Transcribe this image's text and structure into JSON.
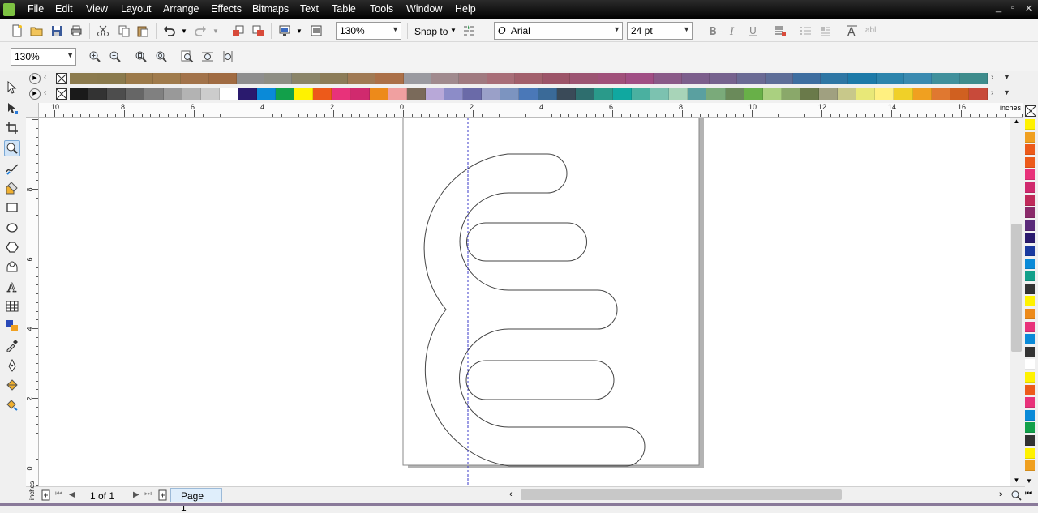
{
  "menubar": {
    "items": [
      "File",
      "Edit",
      "View",
      "Layout",
      "Arrange",
      "Effects",
      "Bitmaps",
      "Text",
      "Table",
      "Tools",
      "Window",
      "Help"
    ]
  },
  "standard_toolbar": {
    "zoom_level": "130%",
    "snap_to_label": "Snap to",
    "font_name": "Arial",
    "font_glyph": "O",
    "font_size": "24 pt"
  },
  "zoom_toolbar": {
    "zoom_level": "130%"
  },
  "rulers": {
    "unit": "inches",
    "horizontal_labels": [
      "10",
      "8",
      "6",
      "4",
      "2",
      "0",
      "2",
      "4",
      "6",
      "8",
      "10",
      "12",
      "14",
      "16"
    ],
    "vertical_labels": [
      "8",
      "6",
      "4",
      "2",
      "0"
    ]
  },
  "status": {
    "page_count": "1 of 1",
    "page_tab": "Page 1",
    "unit": "inches"
  },
  "palette": {
    "row1": [
      "#8c7b4e",
      "#8a7a4d",
      "#9c7a4a",
      "#a07b4c",
      "#a2734a",
      "#a06b42",
      "#8e8e8e",
      "#8e8e84",
      "#8a8468",
      "#8c7c58",
      "#a07a54",
      "#ab7048",
      "#9a9aa0",
      "#a08a8e",
      "#a07a80",
      "#a86e78",
      "#a2606c",
      "#9c5468",
      "#9c5472",
      "#a0507a",
      "#a04e84",
      "#8a5a88",
      "#7c5e8c",
      "#76628e",
      "#6a6a94",
      "#5e6e98",
      "#3e6ea0",
      "#2e76a4",
      "#1c7aa8",
      "#2c84ac",
      "#3a8ab0",
      "#40909c",
      "#3e8c8c"
    ],
    "row2": [
      "#1a1a1a",
      "#333333",
      "#4d4d4d",
      "#666666",
      "#808080",
      "#999999",
      "#b3b3b3",
      "#cccccc",
      "#ffffff",
      "#2a1a6e",
      "#0a8ad8",
      "#12a04a",
      "#fff200",
      "#ed5a1a",
      "#e8327a",
      "#d02a6e",
      "#ed8a1a",
      "#f0a0a0",
      "#7a6a5a",
      "#b8a8d8",
      "#8c8cc8",
      "#6a6aa8",
      "#9aa0c8",
      "#7c94c0",
      "#4a78b8",
      "#3a6a98",
      "#3a4a58",
      "#2e6e6e",
      "#2a9a8a",
      "#10a8a0",
      "#4ab0a0",
      "#7cc2b0",
      "#a8d4b8",
      "#5aa0a0",
      "#7aaa7a",
      "#6a8a5a",
      "#68b048",
      "#aad080",
      "#8aa86a",
      "#6a7a4a",
      "#a0a080",
      "#c8c88a",
      "#e8e878",
      "#fff080",
      "#f0d028",
      "#f0a020",
      "#e07830",
      "#d06020",
      "#c84a3a"
    ],
    "right": [
      "#fff200",
      "#f0a020",
      "#ed5a1a",
      "#ed5a1a",
      "#e8327a",
      "#d02a6e",
      "#c02a5a",
      "#8a2a6a",
      "#5a2a7a",
      "#2a1a6e",
      "#1a3aa0",
      "#0a8ad8",
      "#12a08a",
      "#333333",
      "#fff200",
      "#ed8a1a",
      "#e8327a",
      "#0a8ad8",
      "#333333",
      "#ffffff",
      "#fff200",
      "#ed5a1a",
      "#e8327a",
      "#0a8ad8",
      "#12a04a",
      "#333333",
      "#fff200",
      "#f0a020"
    ]
  }
}
